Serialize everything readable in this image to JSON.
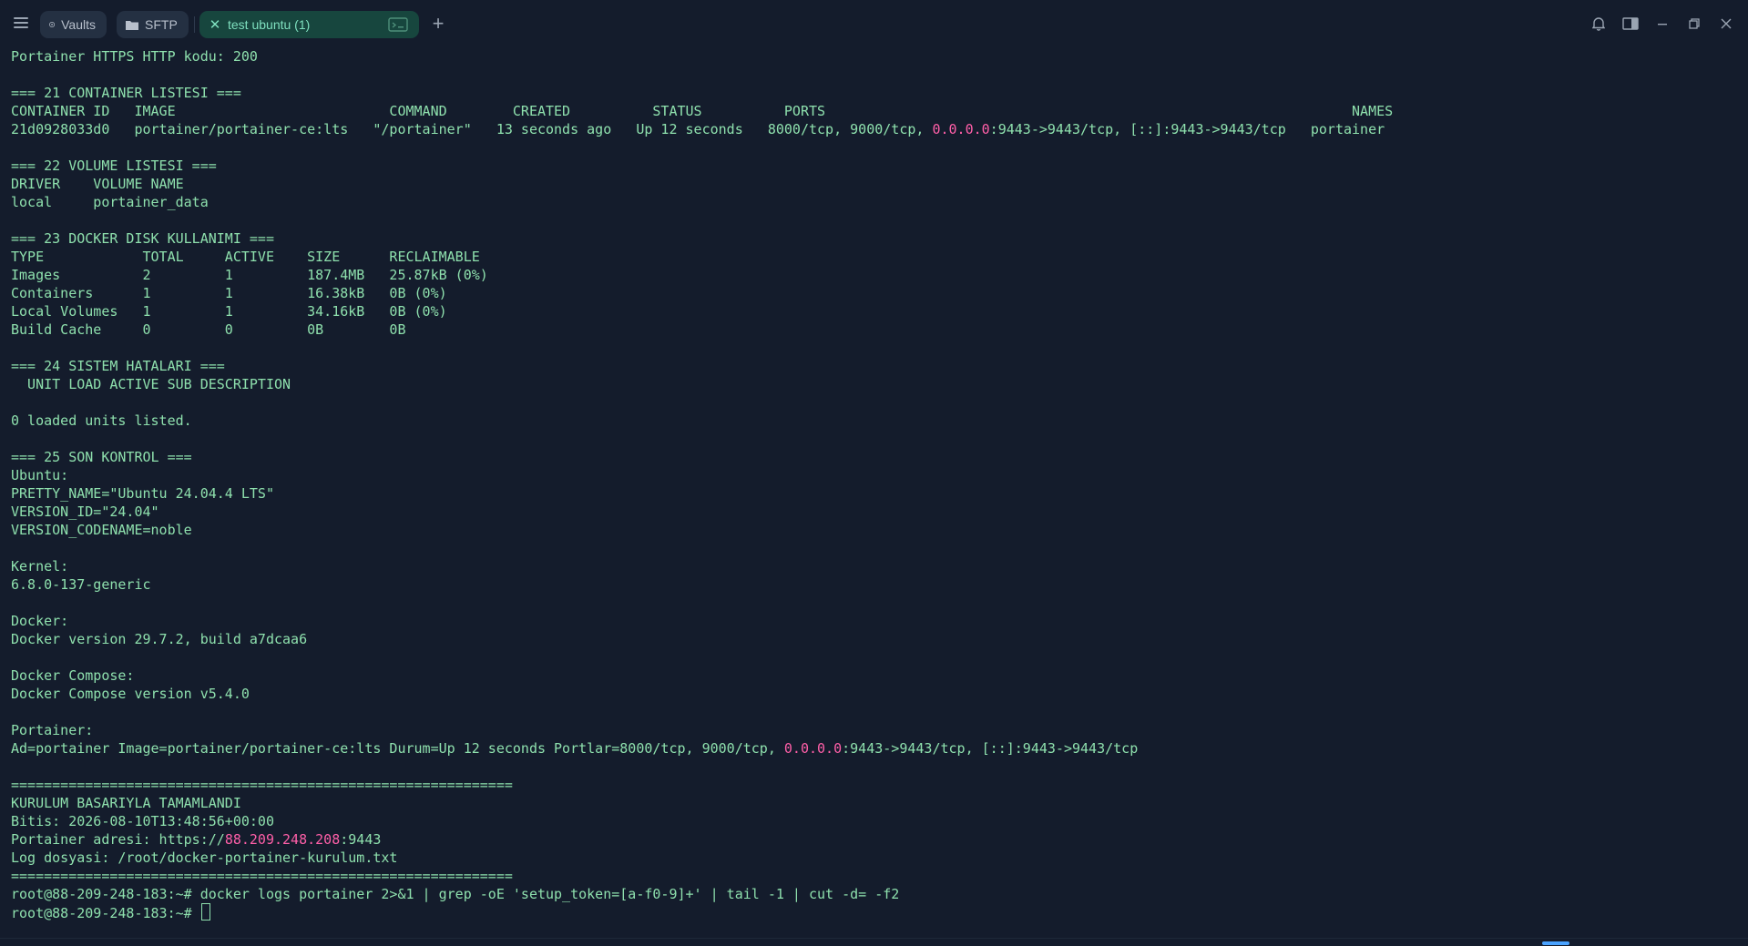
{
  "tabs": {
    "vaults_label": "Vaults",
    "sftp_label": "SFTP",
    "active_label": "test ubuntu (1)",
    "new_tab_label": "+"
  },
  "colors": {
    "background": "#141c2c",
    "terminal_text": "#8ee0ad",
    "highlight": "#ff5fa8",
    "active_tab": "#17463e"
  },
  "icons": [
    "menu-icon",
    "vault-icon",
    "folder-icon",
    "close-icon",
    "terminal-icon",
    "plus-icon",
    "bell-icon",
    "split-view-icon",
    "minimize-icon",
    "restore-icon",
    "window-close-icon"
  ],
  "terminal": {
    "lines": [
      [
        {
          "t": "Portainer HTTPS HTTP kodu: 200"
        }
      ],
      [],
      [
        {
          "t": "=== 21 CONTAINER LISTESI ==="
        }
      ],
      [
        {
          "t": "CONTAINER ID   IMAGE                          COMMAND        CREATED          STATUS          PORTS                                                                NAMES"
        }
      ],
      [
        {
          "t": "21d0928033d0   portainer/portainer-ce:lts   \"/portainer\"   13 seconds ago   Up 12 seconds   8000/tcp, 9000/tcp, "
        },
        {
          "t": "0.0.0.0",
          "c": "pink"
        },
        {
          "t": ":9443->9443/tcp, [::]:9443->9443/tcp   portainer"
        }
      ],
      [],
      [
        {
          "t": "=== 22 VOLUME LISTESI ==="
        }
      ],
      [
        {
          "t": "DRIVER    VOLUME NAME"
        }
      ],
      [
        {
          "t": "local     portainer_data"
        }
      ],
      [],
      [
        {
          "t": "=== 23 DOCKER DISK KULLANIMI ==="
        }
      ],
      [
        {
          "t": "TYPE            TOTAL     ACTIVE    SIZE      RECLAIMABLE"
        }
      ],
      [
        {
          "t": "Images          2         1         187.4MB   25.87kB (0%)"
        }
      ],
      [
        {
          "t": "Containers      1         1         16.38kB   0B (0%)"
        }
      ],
      [
        {
          "t": "Local Volumes   1         1         34.16kB   0B (0%)"
        }
      ],
      [
        {
          "t": "Build Cache     0         0         0B        0B"
        }
      ],
      [],
      [
        {
          "t": "=== 24 SISTEM HATALARI ==="
        }
      ],
      [
        {
          "t": "  UNIT LOAD ACTIVE SUB DESCRIPTION"
        }
      ],
      [],
      [
        {
          "t": "0 loaded units listed."
        }
      ],
      [],
      [
        {
          "t": "=== 25 SON KONTROL ==="
        }
      ],
      [
        {
          "t": "Ubuntu:"
        }
      ],
      [
        {
          "t": "PRETTY_NAME=\"Ubuntu 24.04.4 LTS\""
        }
      ],
      [
        {
          "t": "VERSION_ID=\"24.04\""
        }
      ],
      [
        {
          "t": "VERSION_CODENAME=noble"
        }
      ],
      [],
      [
        {
          "t": "Kernel:"
        }
      ],
      [
        {
          "t": "6.8.0-137-generic"
        }
      ],
      [],
      [
        {
          "t": "Docker:"
        }
      ],
      [
        {
          "t": "Docker version 29.7.2, build a7dcaa6"
        }
      ],
      [],
      [
        {
          "t": "Docker Compose:"
        }
      ],
      [
        {
          "t": "Docker Compose version v5.4.0"
        }
      ],
      [],
      [
        {
          "t": "Portainer:"
        }
      ],
      [
        {
          "t": "Ad=portainer Image=portainer/portainer-ce:lts Durum=Up 12 seconds Portlar=8000/tcp, 9000/tcp, "
        },
        {
          "t": "0.0.0.0",
          "c": "pink"
        },
        {
          "t": ":9443->9443/tcp, [::]:9443->9443/tcp"
        }
      ],
      [],
      [
        {
          "t": "============================================================="
        }
      ],
      [
        {
          "t": "KURULUM BASARIYLA TAMAMLANDI"
        }
      ],
      [
        {
          "t": "Bitis: 2026-08-10T13:48:56+00:00"
        }
      ],
      [
        {
          "t": "Portainer adresi: https://"
        },
        {
          "t": "88.209.248.208",
          "c": "pink"
        },
        {
          "t": ":9443"
        }
      ],
      [
        {
          "t": "Log dosyasi: /root/docker-portainer-kurulum.txt"
        }
      ],
      [
        {
          "t": "============================================================="
        }
      ],
      [
        {
          "t": "root@88-209-248-183:~# docker logs portainer 2>&1 | grep -oE 'setup_token=[a-f0-9]+' | tail -1 | cut -d= -f2"
        }
      ],
      [
        {
          "t": "root@88-209-248-183:~# "
        },
        {
          "t": "",
          "c": "cursor"
        }
      ]
    ]
  }
}
